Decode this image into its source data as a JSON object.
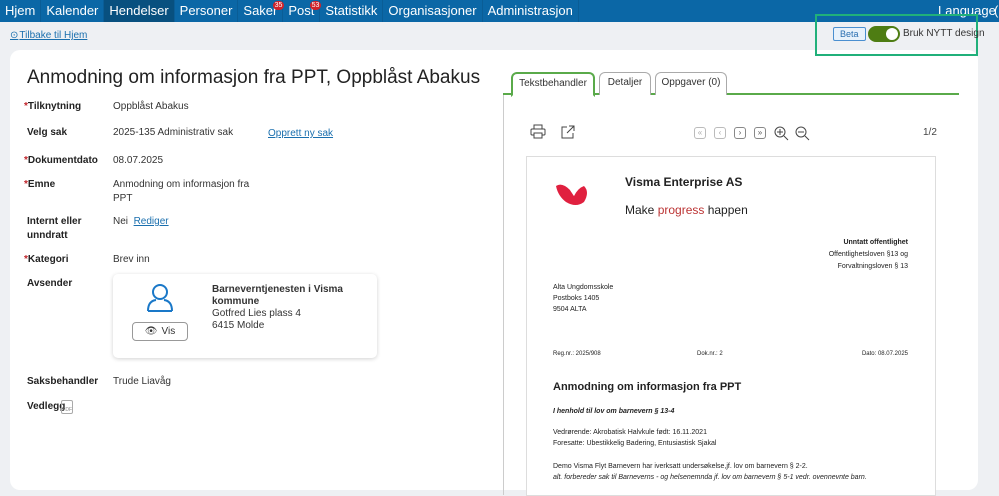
{
  "nav": {
    "items": [
      {
        "label": "Hjem"
      },
      {
        "label": "Kalender"
      },
      {
        "label": "Hendelser",
        "active": true
      },
      {
        "label": "Personer"
      },
      {
        "label": "Saker",
        "badge": "35"
      },
      {
        "label": "Post",
        "badge": "53"
      },
      {
        "label": "Statistikk"
      },
      {
        "label": "Organisasjoner"
      },
      {
        "label": "Administrasjon"
      }
    ],
    "language": "Language",
    "extra": "("
  },
  "back_link": "Tilbake til Hjem",
  "beta": {
    "badge": "Beta",
    "toggle_label": "Bruk NYTT design",
    "toggle_on": true
  },
  "title": "Anmodning om informasjon fra PPT, Oppblåst Abakus",
  "fields": {
    "tilknytning": {
      "label": "Tilknytning",
      "value": "Oppblåst Abakus"
    },
    "velg_sak": {
      "label": "Velg sak",
      "value": "2025-135 Administrativ sak",
      "link": "Opprett ny sak"
    },
    "dokumentdato": {
      "label": "Dokumentdato",
      "value": "08.07.2025"
    },
    "emne": {
      "label": "Emne",
      "value_line1": "Anmodning om informasjon fra",
      "value_line2": "PPT"
    },
    "internt": {
      "label_line1": "Internt eller",
      "label_line2": "unndratt",
      "value": "Nei",
      "link": "Rediger"
    },
    "kategori": {
      "label": "Kategori",
      "value": "Brev inn"
    },
    "avsender": {
      "label": "Avsender",
      "name_line1": "Barneverntjenesten i Visma",
      "name_line2": "kommune",
      "address": "Gotfred Lies plass 4",
      "postal": "6415  Molde",
      "vis": "Vis"
    },
    "saksbehandler": {
      "label": "Saksbehandler",
      "value": "Trude Liavåg"
    },
    "vedlegg": {
      "label": "Vedlegg",
      "icon_text": "PDF"
    }
  },
  "tabs": [
    {
      "label": "Tekstbehandler",
      "active": true
    },
    {
      "label": "Detaljer"
    },
    {
      "label": "Oppgaver (0)"
    }
  ],
  "viewer": {
    "page": "1/2"
  },
  "doc": {
    "company": "Visma Enterprise AS",
    "slogan_pre": "Make ",
    "slogan_hl": "progress",
    "slogan_post": " happen",
    "brand_color": "#e0203f",
    "unntatt": "Unntatt offentlighet",
    "lov1": "Offentlighetsloven §13 og",
    "lov2": "Forvaltningsloven § 13",
    "addr1": "Alta Ungdomsskole",
    "addr2": "Postboks 1405",
    "addr3": "9504 ALTA",
    "regnr": "Reg.nr.: 2025/908",
    "doknr": "Dok.nr.: 2",
    "dato": "Dato: 08.07.2025",
    "heading": "Anmodning om informasjon fra PPT",
    "subheading": "I henhold til lov om barnevern § 13-4",
    "vedr": "Vedrørende: Akrobatisk Halvkule  født:  16.11.2021",
    "foresatte": "Foresatte: Ubestikkelig Badering, Entusiastisk Sjakal",
    "body1": "Demo Visma Flyt Barnevern har iverksatt undersøkelse,jf. lov om barnevern § 2-2.",
    "body2": "alt. forbereder sak til Barneverns - og helsenemnda jf. lov om barnevern § 5-1 vedr. ovennevnte barn."
  }
}
